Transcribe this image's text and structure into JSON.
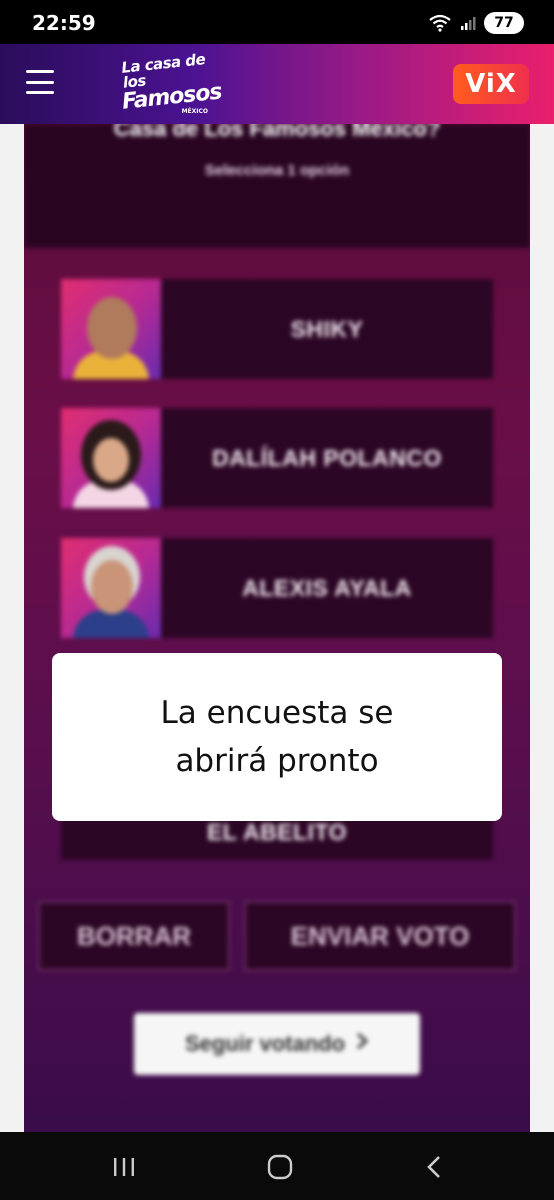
{
  "status_bar": {
    "time": "22:59",
    "battery": "77",
    "icons": [
      "wifi-icon",
      "signal-icon",
      "battery-icon"
    ]
  },
  "header": {
    "menu_icon": "hamburger-menu-icon",
    "brand_logo": {
      "line1": "La casa de los",
      "line2": "Famosos",
      "line3": "MÉXICO"
    },
    "partner_logo": "ViX",
    "colors": {
      "gradient_start": "#2a0d5a",
      "gradient_end": "#ea1f6c",
      "vix_orange": "#ff5d1e"
    }
  },
  "poll": {
    "title": "Casa de Los Famosos México?",
    "subtitle": "Selecciona 1 opción",
    "options": [
      {
        "name": "SHIKY"
      },
      {
        "name": "DALÍLAH POLANCO"
      },
      {
        "name": "ALEXIS AYALA"
      },
      {
        "name": "EL ABELITO"
      }
    ],
    "clear_button": "BORRAR",
    "submit_button": "ENVIAR VOTO",
    "continue_button": "Seguir votando",
    "continue_icon": "chevron-right-icon"
  },
  "dialog": {
    "message_line1": "La encuesta se",
    "message_line2": "abrirá pronto"
  },
  "nav_bar": {
    "buttons": [
      "recent-apps-icon",
      "home-icon",
      "back-icon"
    ]
  }
}
